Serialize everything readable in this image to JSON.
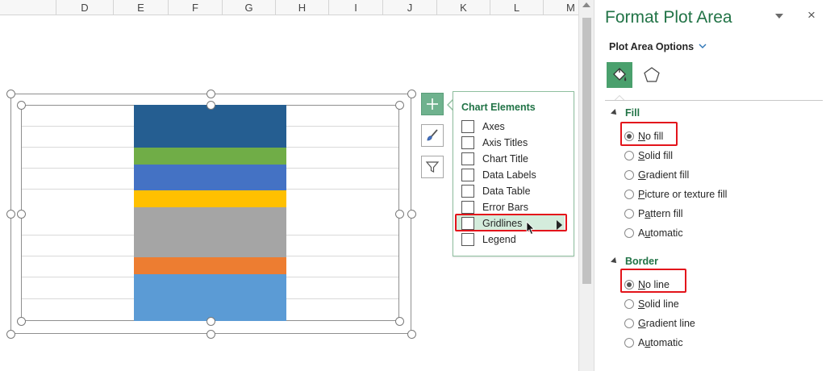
{
  "sheet": {
    "columns": [
      "D",
      "E",
      "F",
      "G",
      "H",
      "I",
      "J",
      "K",
      "L",
      "M"
    ]
  },
  "chart": {
    "segments_top_to_bottom": [
      {
        "color": "#255e91"
      },
      {
        "color": "#70ad47"
      },
      {
        "color": "#4472c4"
      },
      {
        "color": "#ffc000"
      },
      {
        "color": "#a5a5a5"
      },
      {
        "color": "#ed7d31"
      },
      {
        "color": "#5b9bd5"
      }
    ]
  },
  "chart_buttons": [
    {
      "name": "chart-elements-button",
      "icon": "plus-icon"
    },
    {
      "name": "chart-styles-button",
      "icon": "brush-icon"
    },
    {
      "name": "chart-filters-button",
      "icon": "filter-icon"
    }
  ],
  "chart_elements": {
    "title": "Chart Elements",
    "items": [
      {
        "label": "Axes",
        "checked": false
      },
      {
        "label": "Axis Titles",
        "checked": false
      },
      {
        "label": "Chart Title",
        "checked": false
      },
      {
        "label": "Data Labels",
        "checked": false
      },
      {
        "label": "Data Table",
        "checked": false
      },
      {
        "label": "Error Bars",
        "checked": false
      },
      {
        "label": "Gridlines",
        "checked": false
      },
      {
        "label": "Legend",
        "checked": false
      }
    ]
  },
  "pane": {
    "title": "Format Plot Area",
    "close": "×",
    "options_label": "Plot Area Options",
    "fill": {
      "heading": "Fill",
      "options": [
        {
          "label": "No fill",
          "selected": true
        },
        {
          "label": "Solid fill",
          "selected": false
        },
        {
          "label": "Gradient fill",
          "selected": false
        },
        {
          "label": "Picture or texture fill",
          "selected": false
        },
        {
          "label": "Pattern fill",
          "selected": false
        },
        {
          "label": "Automatic",
          "selected": false
        }
      ]
    },
    "border": {
      "heading": "Border",
      "options": [
        {
          "label": "No line",
          "selected": true
        },
        {
          "label": "Solid line",
          "selected": false
        },
        {
          "label": "Gradient line",
          "selected": false
        },
        {
          "label": "Automatic",
          "selected": false
        }
      ]
    }
  },
  "colors": {
    "accent_green": "#217346",
    "highlight_red": "#e3141b"
  }
}
